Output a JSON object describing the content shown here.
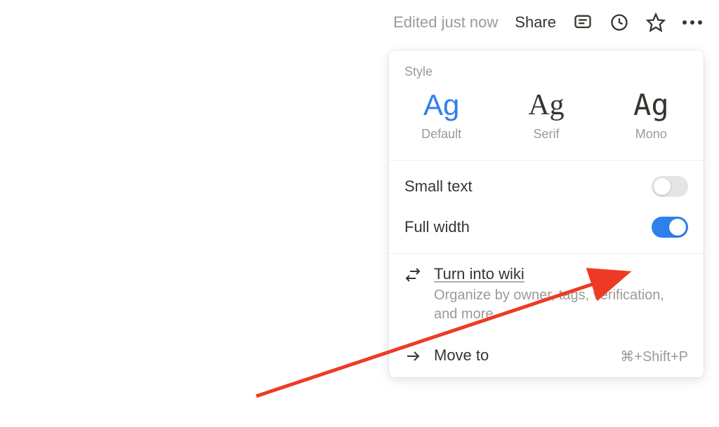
{
  "topbar": {
    "edited_text": "Edited just now",
    "share_text": "Share"
  },
  "dropdown": {
    "style_label": "Style",
    "fonts": [
      {
        "sample": "Ag",
        "name": "Default",
        "selected": true,
        "family": "default"
      },
      {
        "sample": "Ag",
        "name": "Serif",
        "selected": false,
        "family": "serif"
      },
      {
        "sample": "Ag",
        "name": "Mono",
        "selected": false,
        "family": "mono"
      }
    ],
    "toggles": {
      "small_text": {
        "label": "Small text",
        "on": false
      },
      "full_width": {
        "label": "Full width",
        "on": true
      }
    },
    "actions": {
      "turn_into_wiki": {
        "title": "Turn into wiki",
        "subtitle": "Organize by owner, tags, verification, and more"
      },
      "move_to": {
        "title": "Move to",
        "shortcut": "⌘+Shift+P"
      }
    }
  },
  "colors": {
    "accent": "#2f80ed",
    "arrow": "#ee3a24"
  }
}
